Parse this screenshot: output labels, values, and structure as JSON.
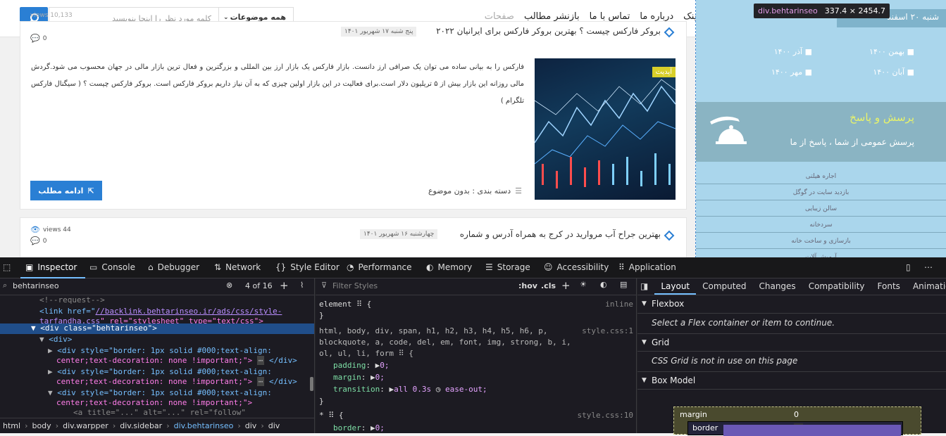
{
  "site": {
    "search": {
      "placeholder": "کلمه مورد نظر را اینجا بنویسید",
      "category": "همه موضوعات"
    },
    "menu": [
      "بک لینک",
      "درباره ما",
      "تماس با ما",
      "بازنشر مطالب",
      "صفحات"
    ],
    "ghost_views": "views 10,133",
    "post1": {
      "title": "بروکر فارکس چیست ؟ بهترین بروکر فارکس برای ایرانیان ۲۰۲۲",
      "date": "پنج شنبه ۱۷ شهریور ۱۴۰۱",
      "comments": "0",
      "excerpt": "فارکس را به بیانی ساده می توان یک صرافی ارز دانست. بازار فارکس یک بازار ارز بین المللی و بزرگترین و فعال ترین بازار مالی در جهان محسوب می شود.گردش مالی روزانه این بازار بیش از ۵ تریلیون دلار است.برای فعالیت در این بازار اولین چیزی که به آن نیاز داریم بروکر فارکس است. بروکر فارکس چیست ؟ ( سیگنال فارکس تلگرام )",
      "badge": "آپدیت",
      "category": "دسته بندی : بدون موضوع",
      "read_more": "ادامه مطلب"
    },
    "post2": {
      "title": "بهترین جراح آب مروارید در کرج به همراه آدرس و شماره",
      "date": "چهارشنبه ۱۶ شهریور ۱۴۰۱",
      "views": "views 44",
      "comments": "0"
    },
    "sidebar": {
      "top": "شنبه ۲۰ اسفند",
      "archives": [
        "بهمن ۱۴۰۰",
        "آذر ۱۴۰۰",
        "آبان ۱۴۰۰",
        "مهر ۱۴۰۰"
      ],
      "qa_title": "پرسش و پاسخ",
      "qa_sub": "پرسش عمومی از شما ، پاسخ از ما",
      "links": [
        "اجاره هیلتی",
        "بازدید سایت در گوگل",
        "سالن زیبایی",
        "سردخانه",
        "بازسازی و ساخت خانه",
        "آرمیش آلات"
      ]
    }
  },
  "highlighter": {
    "class_label": "div.behtarinseo",
    "size": "337.4 × 2454.7"
  },
  "devtools": {
    "tabs": [
      "Inspector",
      "Console",
      "Debugger",
      "Network",
      "Style Editor",
      "Performance",
      "Memory",
      "Storage",
      "Accessibility",
      "Application"
    ],
    "search_value": "behtarinseo",
    "search_count": "4 of 16",
    "html_lines": {
      "l0": "<!--request-->",
      "l1a": "<link href=\"",
      "l1b": "//backlink.behtarinseo.ir/ads/css/style-",
      "l1c": "tarfandha.css",
      "l1d": "\" rel=\"stylesheet\" type=\"text/css\">",
      "l2": "<div class=\"behtarinseo\">",
      "l3": "<div>",
      "l4a": "<div style=\"border: 1px solid #000;text-align:",
      "l4b": "center;text-decoration: none !important;\">",
      "l4c": "</div>",
      "l6a": "<div style=\"border: 1px solid #000;text-align:",
      "l6b": "center;text-decoration: none !important;\">",
      "l6c": "</div>",
      "l8a": "<div style=\"border: 1px solid #000;text-align:",
      "l8b": "center;text-decoration: none !important;\">",
      "l10": "<a title=\"...\" alt=\"...\" rel=\"follow\""
    },
    "breadcrumbs": [
      "html",
      "body",
      "div.warpper",
      "div.sidebar",
      "div.behtarinseo",
      "div",
      "div"
    ],
    "styles": {
      "filter_placeholder": "Filter Styles",
      "hov": ":hov",
      "cls": ".cls",
      "element_selector": "element",
      "inline": "inline",
      "rule1_selector": "html, body, div, span, h1, h2, h3, h4, h5, h6, p,",
      "rule1_selector2": "blockquote, a, code, del, em, font, img, strong, b, i,",
      "rule1_selector3": "ol, ul, li, form",
      "rule1_src": "style.css:1",
      "padding": "padding",
      "padding_val": "0;",
      "margin": "margin",
      "margin_val": "0;",
      "transition": "transition",
      "transition_val": "all 0.3s",
      "transition_val2": "ease-out;",
      "rule2_selector": "*",
      "rule2_src": "style.css:10",
      "border": "border",
      "border_val": "0;"
    },
    "layout": {
      "tabs": [
        "Layout",
        "Computed",
        "Changes",
        "Compatibility",
        "Fonts",
        "Animations"
      ],
      "flexbox": "Flexbox",
      "flexbox_msg": "Select a Flex container or item to continue.",
      "grid": "Grid",
      "grid_msg": "CSS Grid is not in use on this page",
      "box_model": "Box Model",
      "margin_label": "margin",
      "margin_val": "0",
      "border_label": "border",
      "border_val": "0"
    }
  }
}
